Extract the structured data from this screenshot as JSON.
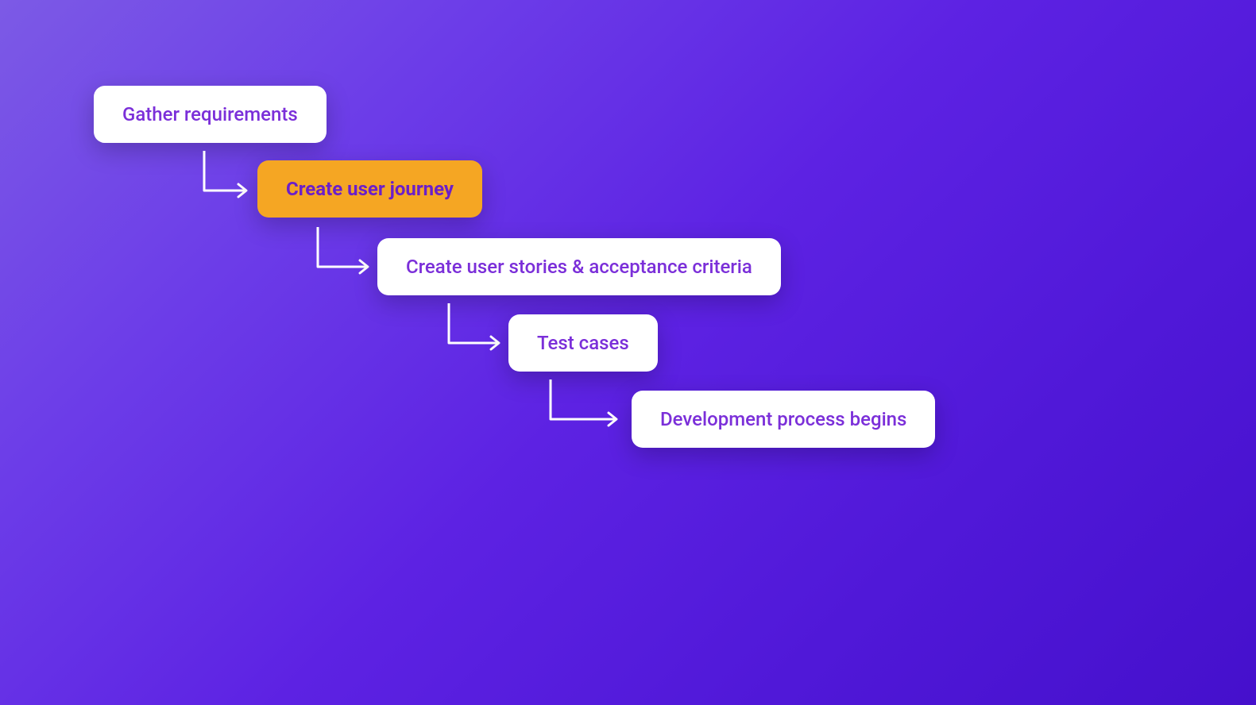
{
  "steps": [
    {
      "label": "Gather requirements",
      "highlighted": false
    },
    {
      "label": "Create user journey",
      "highlighted": true
    },
    {
      "label": "Create user stories & acceptance criteria",
      "highlighted": false
    },
    {
      "label": "Test cases",
      "highlighted": false
    },
    {
      "label": "Development process begins",
      "highlighted": false
    }
  ],
  "colors": {
    "accent": "#f5a623",
    "text": "#7b2fd9",
    "card": "#ffffff"
  }
}
